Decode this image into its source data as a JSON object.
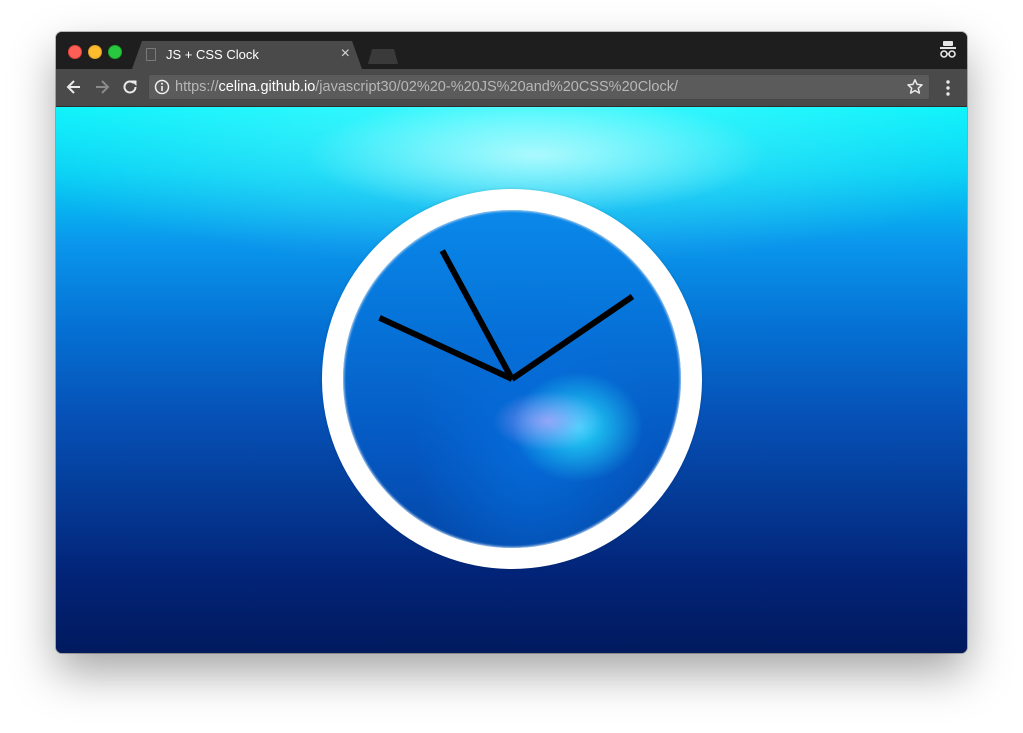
{
  "browser": {
    "tab": {
      "title": "JS + CSS Clock",
      "close_symbol": "×"
    },
    "address_bar": {
      "scheme": "https://",
      "host": "celina.github.io",
      "path": "/javascript30/02%20-%20JS%20and%20CSS%20Clock/"
    },
    "icons": [
      "back-arrow-icon",
      "forward-arrow-icon",
      "reload-icon",
      "info-icon",
      "star-icon",
      "menu-icon",
      "incognito-icon"
    ]
  },
  "clock": {
    "hands": [
      {
        "name": "hand-a",
        "angle_deg": 55.6
      },
      {
        "name": "hand-b",
        "angle_deg": -28.5
      },
      {
        "name": "hand-c",
        "angle_deg": -65.2
      }
    ],
    "colors": {
      "ring": "#ffffff",
      "hands": "#000000"
    }
  },
  "colors": {
    "water_top": "#08f3fb",
    "water_bottom": "#011a5e",
    "tab_active": "#4a4a4b",
    "tabstrip": "#1e1e1f"
  }
}
